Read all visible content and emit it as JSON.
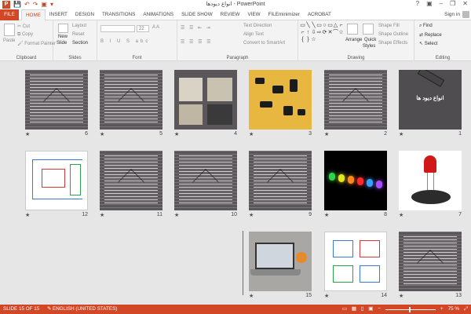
{
  "window": {
    "title": "انواع دیودها - PowerPoint",
    "help": "?",
    "minimize": "–",
    "restore": "❐",
    "close": "✕"
  },
  "tabs": {
    "file": "FILE",
    "items": [
      "HOME",
      "INSERT",
      "DESIGN",
      "TRANSITIONS",
      "ANIMATIONS",
      "SLIDE SHOW",
      "REVIEW",
      "VIEW",
      "FILEminimizer",
      "ACROBAT"
    ],
    "active": "HOME",
    "sign_in": "Sign in"
  },
  "ribbon": {
    "clipboard": {
      "label": "Clipboard",
      "paste": "Paste",
      "cut": "Cut",
      "copy": "Copy",
      "format_painter": "Format Painter"
    },
    "slides": {
      "label": "Slides",
      "new_slide": "New",
      "new_slide2": "Slide",
      "layout": "Layout",
      "reset": "Reset",
      "section": "Section"
    },
    "font": {
      "label": "Font",
      "size": "22"
    },
    "paragraph": {
      "label": "Paragraph",
      "text_direction": "Text Direction",
      "align_text": "Align Text",
      "smartart": "Convert to SmartArt"
    },
    "drawing": {
      "label": "Drawing",
      "arrange": "Arrange",
      "quick_styles": "Quick",
      "quick_styles2": "Styles",
      "shape_fill": "Shape Fill",
      "shape_outline": "Shape Outline",
      "shape_effects": "Shape Effects"
    },
    "editing": {
      "label": "Editing",
      "find": "Find",
      "replace": "Replace",
      "select": "Select"
    }
  },
  "slides": [
    {
      "num": "1",
      "kind": "title",
      "title": "انواع دیود ها"
    },
    {
      "num": "2",
      "kind": "dark"
    },
    {
      "num": "3",
      "kind": "parts"
    },
    {
      "num": "4",
      "kind": "photo"
    },
    {
      "num": "5",
      "kind": "dark"
    },
    {
      "num": "6",
      "kind": "dark"
    },
    {
      "num": "7",
      "kind": "redled"
    },
    {
      "num": "8",
      "kind": "led"
    },
    {
      "num": "9",
      "kind": "dark"
    },
    {
      "num": "10",
      "kind": "dark"
    },
    {
      "num": "11",
      "kind": "dark"
    },
    {
      "num": "12",
      "kind": "circuit"
    },
    {
      "num": "13",
      "kind": "dark"
    },
    {
      "num": "14",
      "kind": "circuit"
    },
    {
      "num": "15",
      "kind": "laptop"
    }
  ],
  "star": "★",
  "status": {
    "slide_info": "SLIDE 15 OF 15",
    "language": "ENGLISH (UNITED STATES)",
    "zoom": "75 %",
    "zoom_out": "−",
    "zoom_in": "+"
  }
}
